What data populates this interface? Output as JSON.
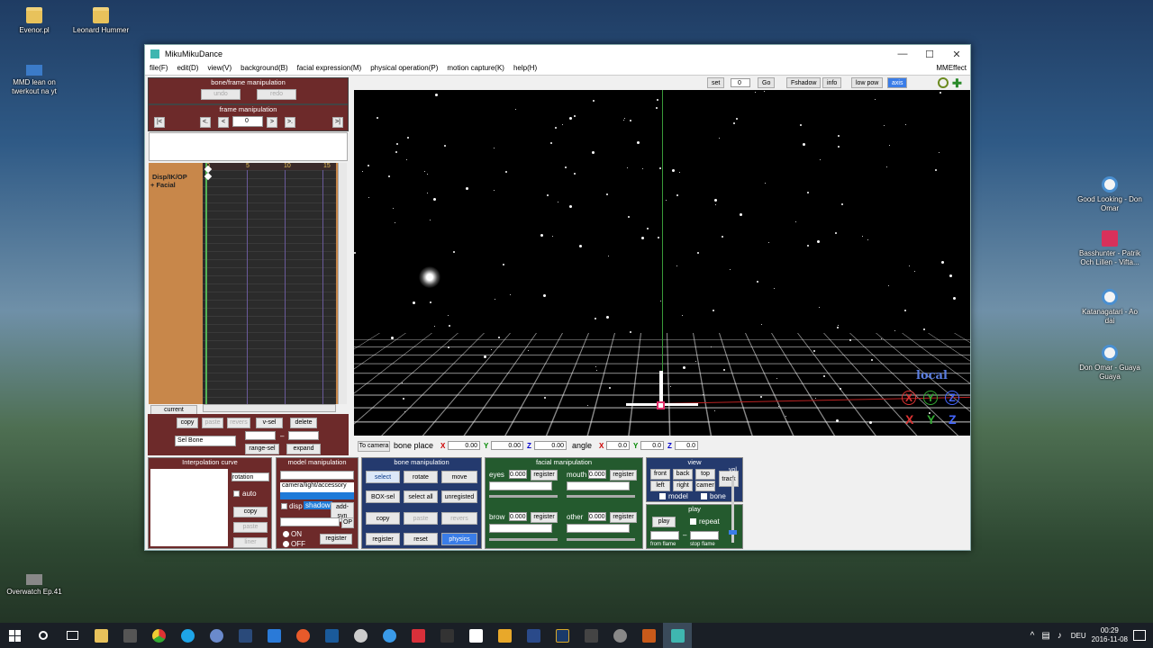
{
  "desktop": {
    "icons_left": [
      {
        "label": "Evenor.pl"
      },
      {
        "label": "Leonard Hummer"
      },
      {
        "label": "MMD lean on twerkout na yt"
      },
      {
        "label": "Overwatch Ep.41"
      }
    ],
    "icons_right": [
      {
        "label": "Good Looking - Don Omar"
      },
      {
        "label": "Basshunter - Patrik Och Lillen - Vifta..."
      },
      {
        "label": "Katanagatari - Ao dai"
      },
      {
        "label": "Don Omar - Guaya Guaya"
      }
    ]
  },
  "window": {
    "title": "MikuMikuDance",
    "minimize": "—",
    "maximize": "☐",
    "close": "✕"
  },
  "menu": {
    "items": [
      "file(F)",
      "edit(D)",
      "view(V)",
      "background(B)",
      "facial expression(M)",
      "physical operation(P)",
      "motion capture(K)",
      "help(H)"
    ],
    "right": "MMEffect"
  },
  "bone_frame": {
    "title": "bone/frame manipulation",
    "undo": "undo",
    "redo": "redo"
  },
  "frame_manip": {
    "title": "frame manipulation",
    "first": "|<",
    "prev_key": "<.",
    "prev": "<",
    "frame": "0",
    "next": ">",
    "next_key": ">.",
    "last": ">|"
  },
  "timeline": {
    "ticks": [
      "0",
      "5",
      "10",
      "15"
    ],
    "rows": [
      "Disp/IK/OP",
      "+ Facial"
    ]
  },
  "frame_ops": {
    "current": "current",
    "copy": "copy",
    "paste": "paste",
    "revers": "revers",
    "vsel": "v-sel",
    "delete": "delete",
    "sel_bone": "Sel Bone",
    "dash": "–",
    "range_sel": "range-sel",
    "expand": "expand"
  },
  "viewbar": {
    "set": "set",
    "frame": "0",
    "go": "Go",
    "fshadow": "Fshadow",
    "info": "info",
    "lowpow": "low pow",
    "axis": "axis"
  },
  "viewport": {
    "local": "local",
    "axes": [
      "X",
      "Y",
      "Z"
    ]
  },
  "placebar": {
    "to_camera": "To camera",
    "bone_place": "bone place",
    "x_lbl": "X",
    "x": "0.00",
    "y_lbl": "Y",
    "y": "0.00",
    "z_lbl": "Z",
    "z": "0.00",
    "angle": "angle",
    "ax": "0.0",
    "ay": "0.0",
    "az": "0.0"
  },
  "interp": {
    "title": "Interpolation curve",
    "select": "rotation",
    "auto": "auto",
    "copy": "copy",
    "paste": "paste",
    "liner": "liner"
  },
  "model": {
    "title": "model manipulation",
    "selected": "camera/light/accessory",
    "disp": "disp",
    "shadow": "shadow",
    "addsyn": "add-syn",
    "op": "OP",
    "on": "ON",
    "off": "OFF",
    "register": "register"
  },
  "bone": {
    "title": "bone manipulation",
    "select": "select",
    "rotate": "rotate",
    "move": "move",
    "boxsel": "BOX-sel",
    "selectall": "select all",
    "unregistered": "unregisted",
    "copy": "copy",
    "paste": "paste",
    "revers": "revers",
    "register": "register",
    "reset": "reset",
    "physics": "physics"
  },
  "facial": {
    "title": "facial manipulation",
    "eyes": "eyes",
    "eyes_val": "0.000",
    "mouth": "mouth",
    "mouth_val": "0.000",
    "brow": "brow",
    "brow_val": "0.000",
    "other": "other",
    "other_val": "0.000",
    "register": "register"
  },
  "view": {
    "title": "view",
    "front": "front",
    "back": "back",
    "top": "top",
    "track": "track",
    "left": "left",
    "right": "right",
    "camer": "camer",
    "model": "model",
    "bone": "bone"
  },
  "play": {
    "title": "play",
    "play": "play",
    "repeat": "repeat",
    "vol": "vol",
    "from": "from flame",
    "stop": "stop flame",
    "dash": "–"
  },
  "taskbar": {
    "lang": "DEU",
    "time": "00:29",
    "date": "2016-11-08"
  },
  "colors": {
    "accent": "#6d2a2a",
    "green": "#245a2e",
    "blue": "#243a6e"
  }
}
